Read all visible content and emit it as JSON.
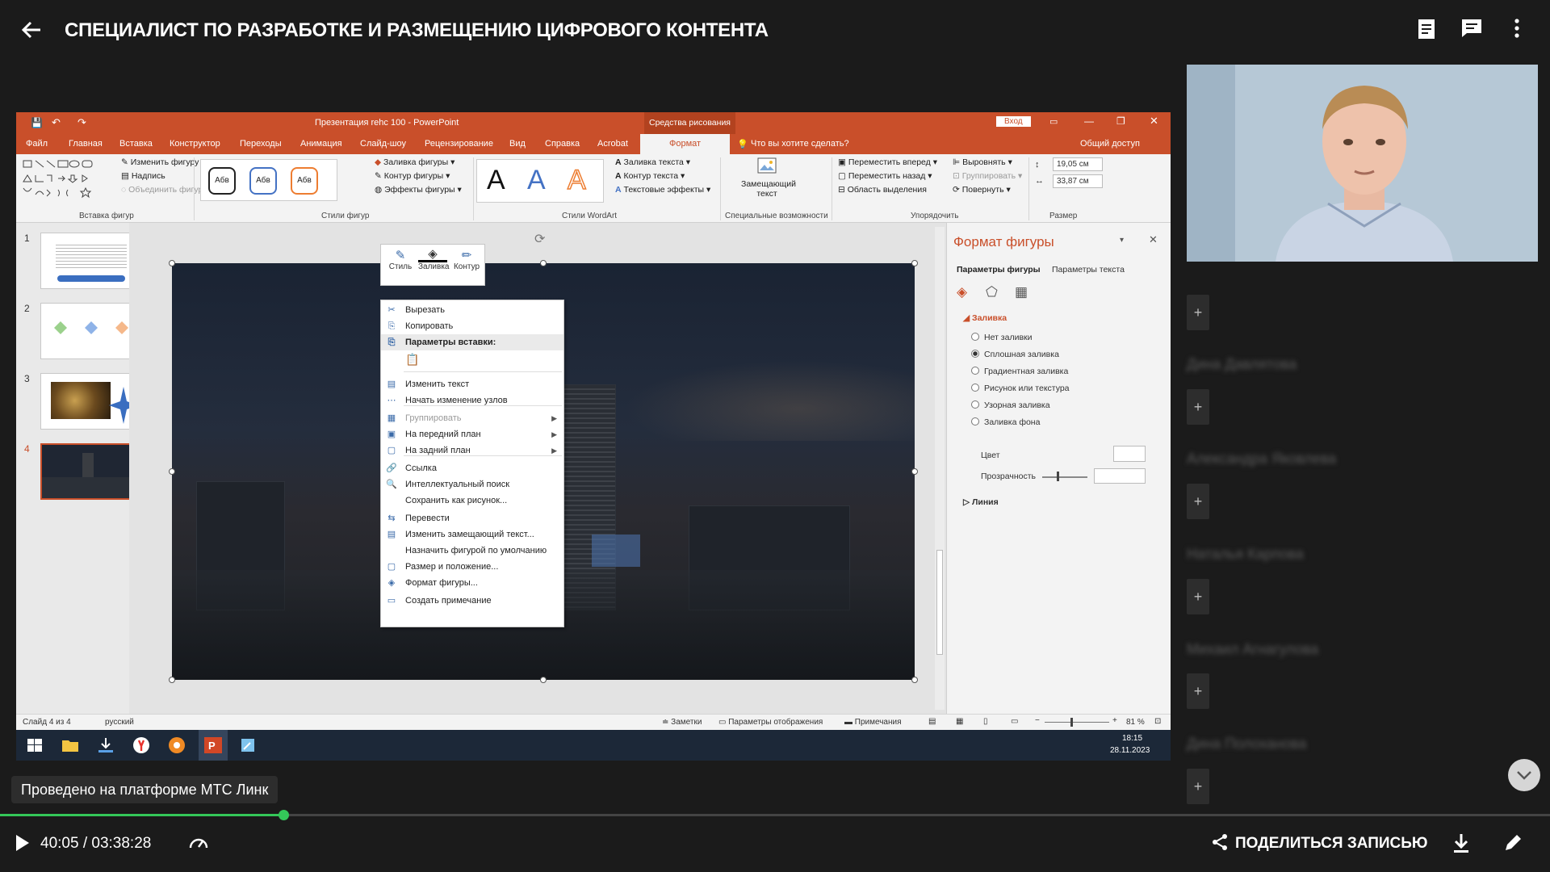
{
  "header": {
    "title": "СПЕЦИАЛИСТ ПО РАЗРАБОТКЕ И РАЗМЕЩЕНИЮ ЦИФРОВОГО КОНТЕНТА"
  },
  "ppt": {
    "window_title": "Презентация rehc 100  -  PowerPoint",
    "drawing_tools": "Средства рисования",
    "login": "Вход",
    "tabs": [
      "Файл",
      "Главная",
      "Вставка",
      "Конструктор",
      "Переходы",
      "Анимация",
      "Слайд-шоу",
      "Рецензирование",
      "Вид",
      "Справка",
      "Acrobat",
      "Формат"
    ],
    "tell_me": "Что вы хотите сделать?",
    "share": "Общий доступ",
    "ribbon": {
      "change_shape": "Изменить фигуру",
      "caption": "Надпись",
      "merge_shapes": "Объединить фигуры",
      "insert_shapes": "Вставка фигур",
      "style_sample": "Абв",
      "shape_fill": "Заливка фигуры",
      "shape_outline": "Контур фигуры",
      "shape_effects": "Эффекты фигуры",
      "shape_styles": "Стили фигур",
      "wordart_letter": "A",
      "text_fill": "Заливка текста",
      "text_outline": "Контур текста",
      "text_effects": "Текстовые эффекты",
      "wordart_styles": "Стили WordArt",
      "alt_text": "Замещающий текст",
      "accessibility": "Специальные возможности",
      "bring_forward": "Переместить вперед",
      "send_backward": "Переместить назад",
      "selection_pane": "Область выделения",
      "align": "Выровнять",
      "group": "Группировать",
      "rotate": "Повернуть",
      "arrange": "Упорядочить",
      "height": "19,05 см",
      "width": "33,87 см",
      "size": "Размер"
    },
    "slides": [
      "1",
      "2",
      "3",
      "4"
    ],
    "mini_toolbar": [
      "Стиль",
      "Заливка",
      "Контур"
    ],
    "context_menu": [
      {
        "label": "Вырезать",
        "state": "normal"
      },
      {
        "label": "Копировать",
        "state": "normal"
      },
      {
        "label": "Параметры вставки:",
        "state": "header"
      },
      {
        "label": "",
        "state": "paste"
      },
      {
        "label": "Изменить текст",
        "state": "normal"
      },
      {
        "label": "Начать изменение узлов",
        "state": "normal"
      },
      {
        "label": "Группировать",
        "state": "disabled"
      },
      {
        "label": "На передний план",
        "state": "normal"
      },
      {
        "label": "На задний план",
        "state": "normal"
      },
      {
        "label": "Ссылка",
        "state": "normal"
      },
      {
        "label": "Интеллектуальный поиск",
        "state": "normal"
      },
      {
        "label": "Сохранить как рисунок...",
        "state": "normal"
      },
      {
        "label": "Перевести",
        "state": "normal"
      },
      {
        "label": "Изменить замещающий текст...",
        "state": "normal"
      },
      {
        "label": "Назначить фигурой по умолчанию",
        "state": "normal"
      },
      {
        "label": "Размер и положение...",
        "state": "normal"
      },
      {
        "label": "Формат фигуры...",
        "state": "normal"
      },
      {
        "label": "Создать примечание",
        "state": "normal"
      }
    ],
    "format_pane": {
      "title": "Формат фигуры",
      "tab_shape": "Параметры фигуры",
      "tab_text": "Параметры текста",
      "fill_section": "Заливка",
      "fill_options": [
        "Нет заливки",
        "Сплошная заливка",
        "Градиентная заливка",
        "Рисунок или текстура",
        "Узорная заливка",
        "Заливка фона"
      ],
      "selected_fill": "Сплошная заливка",
      "color_label": "Цвет",
      "transparency_label": "Прозрачность",
      "transparency_value": "35 %",
      "line_section": "Линия"
    },
    "status": {
      "slide_counter": "Слайд 4 из 4",
      "language": "русский",
      "notes": "Заметки",
      "display_settings": "Параметры отображения",
      "comments": "Примечания",
      "zoom": "81 %"
    },
    "clock": {
      "time": "18:15",
      "date": "28.11.2023"
    }
  },
  "participants": [
    "Дина Давлятова",
    "Александра Яковлева",
    "Наталья Карпова",
    "Михаил Агнагулова",
    "Дина Полоханова"
  ],
  "platform_badge": "Проведено на платформе МТС Линк",
  "player": {
    "time": "40:05 / 03:38:28",
    "progress": 0.183,
    "share_label": "ПОДЕЛИТЬСЯ ЗАПИСЬЮ"
  },
  "colors": {
    "accent": "#34c759",
    "ppt_brand": "#c94f2a",
    "background": "#1b1b1b"
  }
}
